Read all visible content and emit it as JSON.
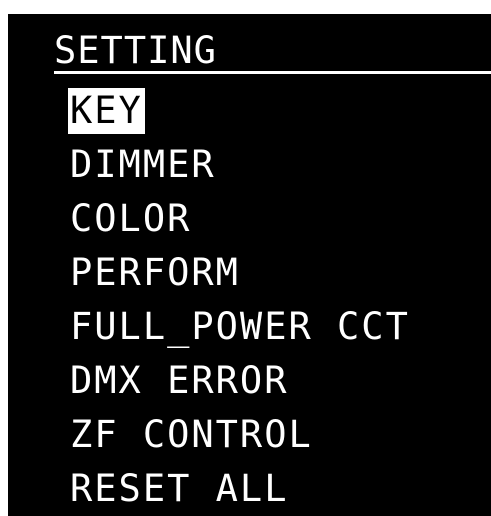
{
  "screen": {
    "title": "SETTING",
    "selected_index": 0,
    "items": [
      {
        "label": "KEY"
      },
      {
        "label": "DIMMER"
      },
      {
        "label": "COLOR"
      },
      {
        "label": "PERFORM"
      },
      {
        "label": "FULL_POWER CCT"
      },
      {
        "label": "DMX ERROR"
      },
      {
        "label": "ZF CONTROL"
      },
      {
        "label": "RESET ALL"
      }
    ]
  },
  "colors": {
    "background": "#000000",
    "foreground": "#ffffff",
    "highlight_bg": "#ffffff",
    "highlight_fg": "#000000"
  }
}
